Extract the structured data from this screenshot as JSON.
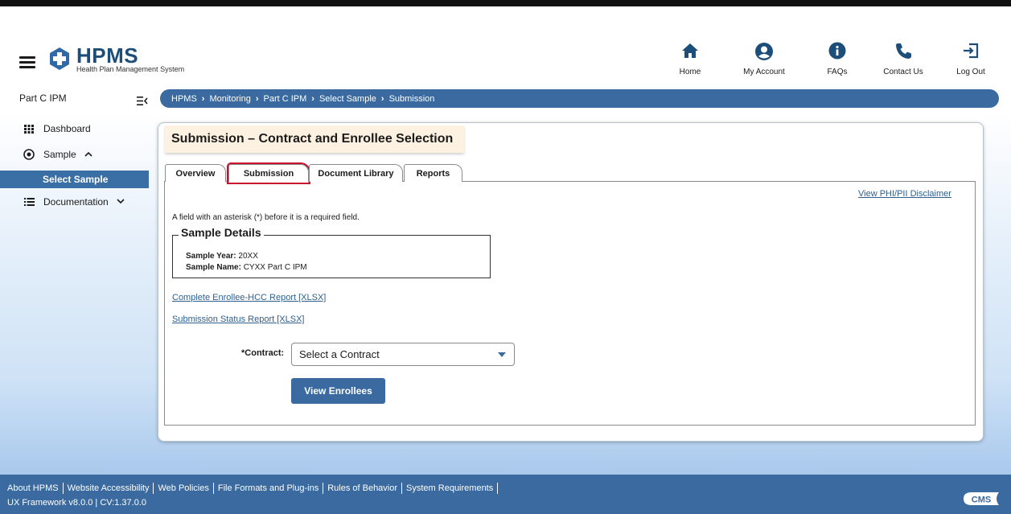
{
  "header": {
    "logo_text": "HPMS",
    "logo_subtitle": "Health Plan Management System",
    "nav": [
      {
        "label": "Home",
        "icon": "home-icon"
      },
      {
        "label": "My Account",
        "icon": "account-icon"
      },
      {
        "label": "FAQs",
        "icon": "info-icon"
      },
      {
        "label": "Contact Us",
        "icon": "phone-icon"
      },
      {
        "label": "Log Out",
        "icon": "logout-icon"
      }
    ]
  },
  "sidebar": {
    "title": "Part C IPM",
    "items": [
      {
        "label": "Dashboard",
        "icon": "grid-icon"
      },
      {
        "label": "Sample",
        "icon": "target-icon",
        "chevron": "^"
      },
      {
        "label": "Select Sample",
        "selected": true
      },
      {
        "label": "Documentation",
        "icon": "list-icon",
        "chevron": "v"
      }
    ]
  },
  "breadcrumb": [
    "HPMS",
    "Monitoring",
    "Part C IPM",
    "Select Sample",
    "Submission"
  ],
  "page_title": "Submission – Contract and Enrollee Selection",
  "tabs": [
    {
      "label": "Overview"
    },
    {
      "label": "Submission",
      "active": true
    },
    {
      "label": "Document Library"
    },
    {
      "label": "Reports"
    }
  ],
  "content": {
    "disclaimer_link": "View PHI/PII Disclaimer",
    "required_note": "A field with an asterisk (*) before it is a required field.",
    "sample_details": {
      "legend": "Sample Details",
      "year_label": "Sample Year:",
      "year_value": "20XX",
      "name_label": "Sample Name:",
      "name_value": "CYXX Part C IPM"
    },
    "links": [
      "Complete Enrollee-HCC Report [XLSX]",
      "Submission Status Report [XLSX]"
    ],
    "contract_label": "*Contract:",
    "contract_selected": "Select a Contract",
    "view_button": "View Enrollees"
  },
  "footer": {
    "links": [
      "About HPMS",
      "Website Accessibility",
      "Web Policies",
      "File Formats and Plug-ins",
      "Rules of Behavior",
      "System Requirements"
    ],
    "version": "UX Framework v8.0.0 | CV:1.37.0.0",
    "logo": "CMS"
  },
  "colors": {
    "primary": "#3a6aa0",
    "title_bg": "#fdf2e1",
    "highlight": "#c8102e",
    "link": "#2e5f8f"
  }
}
